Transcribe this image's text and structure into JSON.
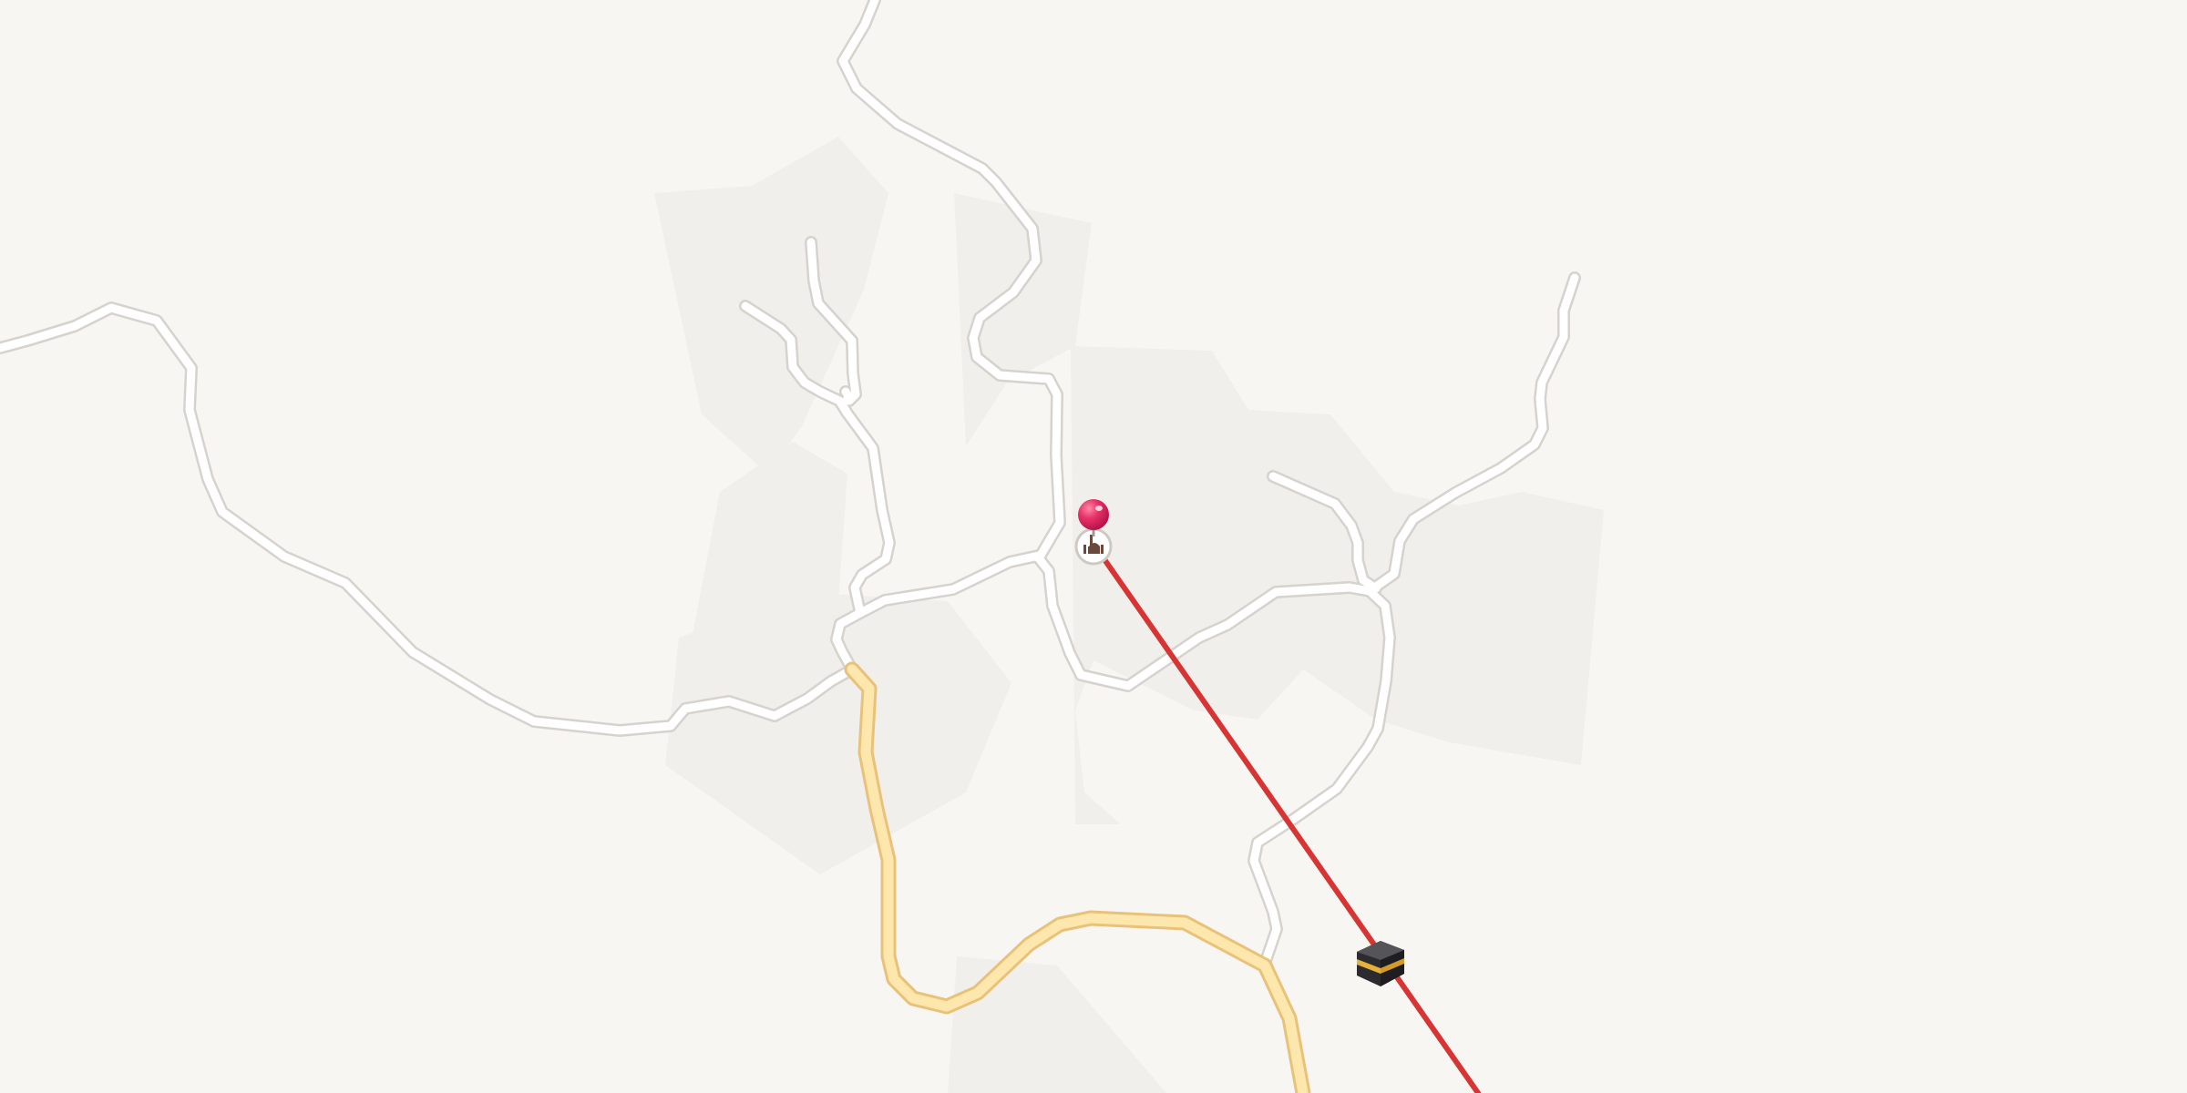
{
  "map": {
    "kind": "street-map",
    "colors": {
      "background": "#f8f6f3",
      "landuse": "#f1efec",
      "minor_road": "#ffffff",
      "minor_road_casing": "#d6d2cd",
      "major_road": "#fde7ad",
      "major_road_casing": "#e9c27a",
      "direction_line": "#d73534",
      "pin": "#e8336a"
    },
    "markers": {
      "location_pin": {
        "icon": "map-pin-icon"
      },
      "mosque": {
        "icon": "mosque-icon"
      },
      "kaaba": {
        "icon": "kaaba-icon"
      }
    },
    "direction_line": {
      "icon": "qibla-direction-line"
    }
  }
}
